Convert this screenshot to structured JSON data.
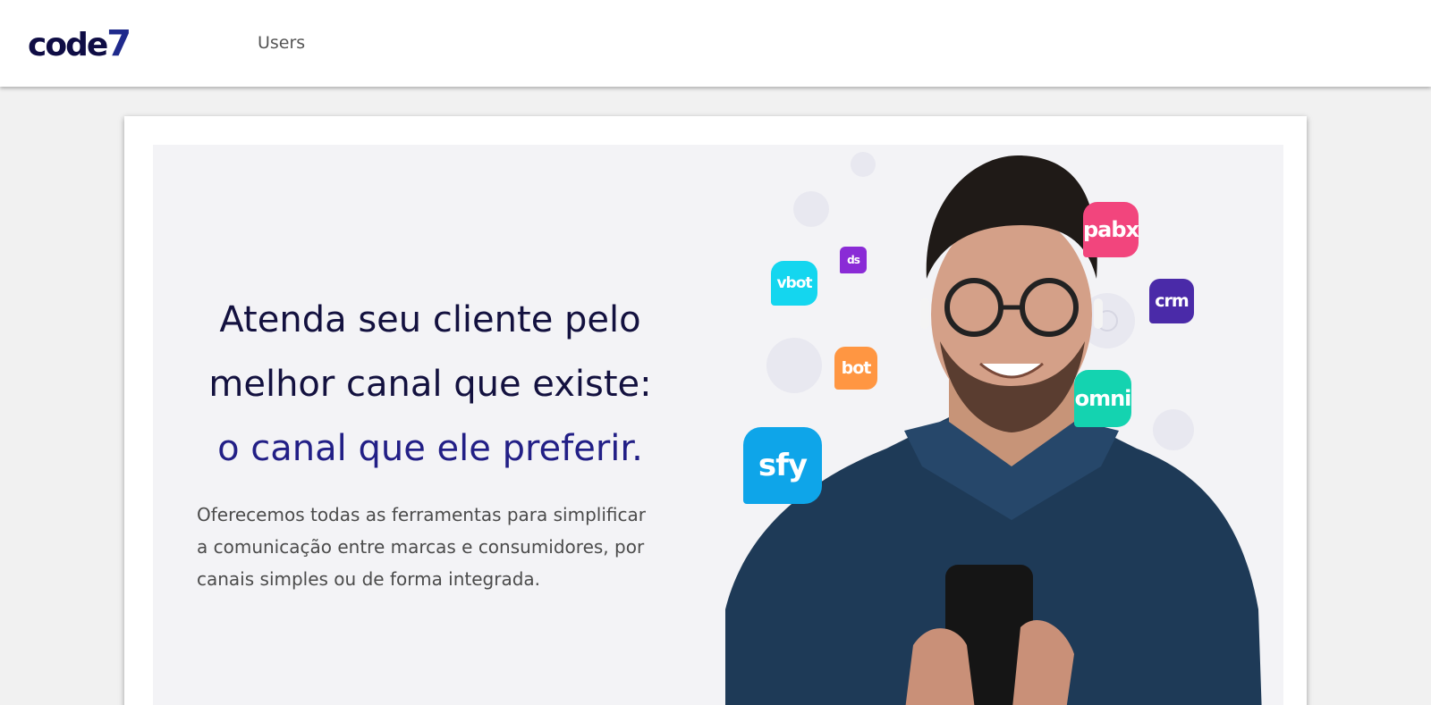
{
  "header": {
    "logo_text": "code",
    "logo_number": "7",
    "nav_users": "Users"
  },
  "hero": {
    "headline_line1": "Atenda seu cliente pelo",
    "headline_line2": "melhor canal que existe:",
    "headline_line3": "o canal que ele preferir.",
    "subtext": "Oferecemos todas as ferramentas para simplificar a comunicação entre marcas e consumidores, por canais simples ou de forma integrada."
  },
  "badges": {
    "pabx": "pabx",
    "crm": "crm",
    "ds": "ds",
    "vbot": "vbot",
    "bot": "bot",
    "omni": "omni",
    "sfy": "sfy"
  },
  "colors": {
    "brand_dark": "#0f0d45",
    "brand_accent": "#221f86",
    "pabx": "#f2457d",
    "crm": "#4a2aa8",
    "ds": "#8a2bd6",
    "vbot": "#14d6ef",
    "bot": "#ff9642",
    "omni": "#14d3b0",
    "sfy": "#0ea5e9"
  }
}
